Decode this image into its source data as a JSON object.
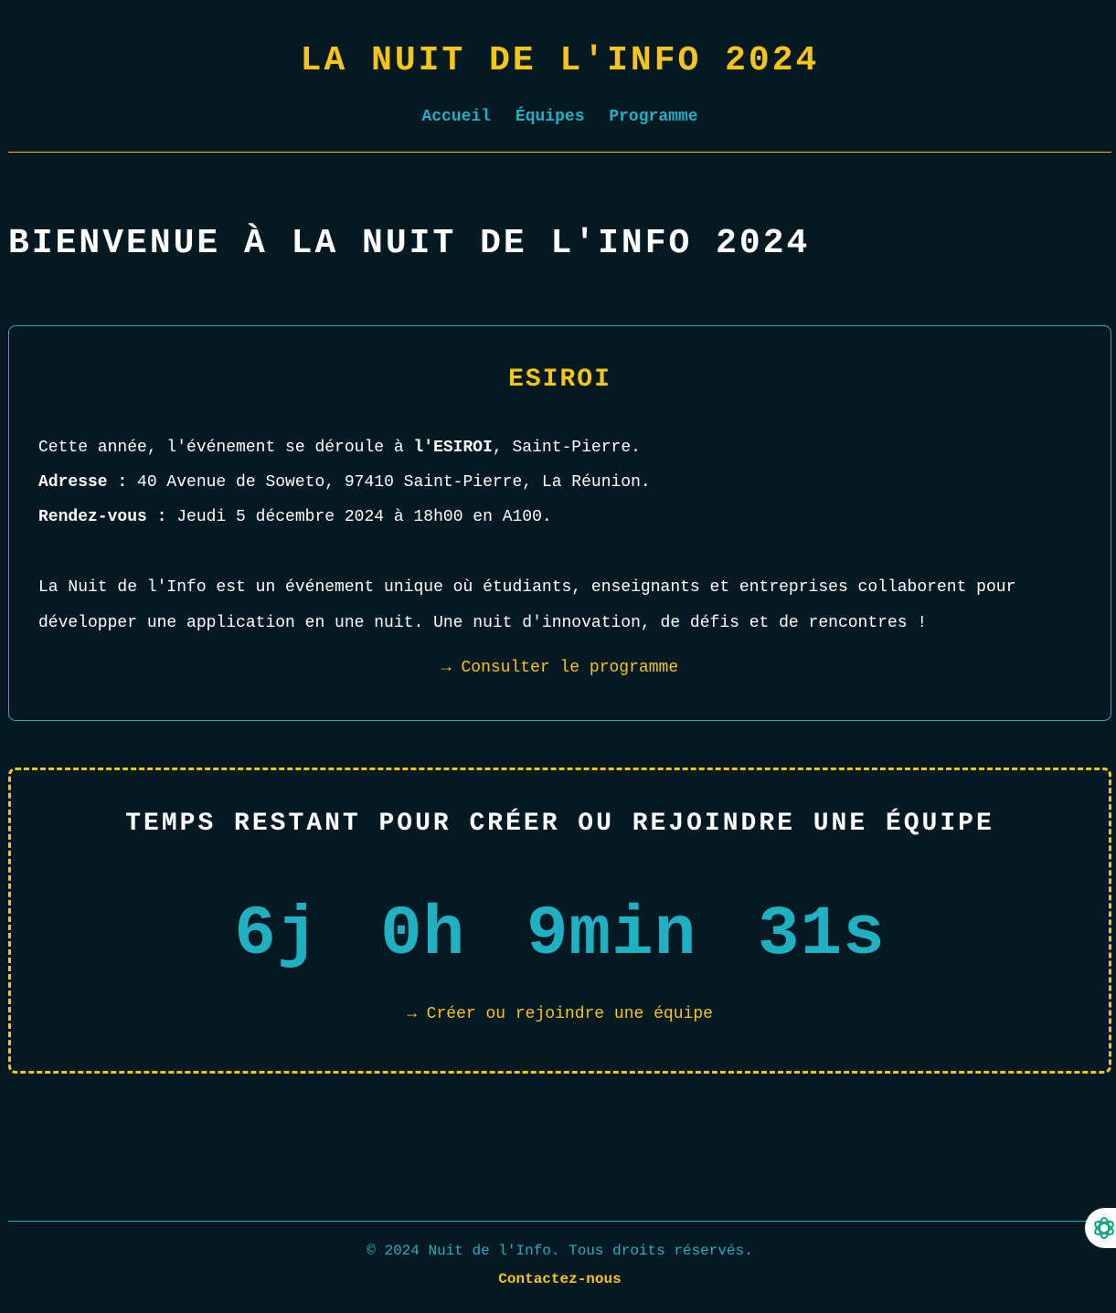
{
  "header": {
    "site_title": "LA NUIT DE L'INFO 2024",
    "nav": [
      {
        "label": "Accueil"
      },
      {
        "label": "Équipes"
      },
      {
        "label": "Programme"
      }
    ]
  },
  "main": {
    "welcome_title": "BIENVENUE À LA NUIT DE L'INFO 2024",
    "info_card": {
      "title": "ESIROI",
      "intro_prefix": "Cette année, l'événement se déroule à ",
      "intro_bold": "l'ESIROI",
      "intro_suffix": ", Saint-Pierre.",
      "address_label": "Adresse :",
      "address_value": " 40 Avenue de Soweto, 97410 Saint-Pierre, La Réunion.",
      "meeting_label": "Rendez-vous :",
      "meeting_value": " Jeudi 5 décembre 2024 à 18h00 en A100.",
      "description": "La Nuit de l'Info est un événement unique où étudiants, enseignants et entreprises collaborent pour développer une application en une nuit. Une nuit d'innovation, de défis et de rencontres !",
      "link_label": "→ Consulter le programme"
    },
    "countdown_card": {
      "title": "TEMPS RESTANT POUR CRÉER OU REJOINDRE UNE ÉQUIPE",
      "days": "6j",
      "hours": "0h",
      "minutes": "9min",
      "seconds": "31s",
      "link_label": "→ Créer ou rejoindre une équipe"
    }
  },
  "footer": {
    "copyright": "© 2024 Nuit de l'Info. Tous droits réservés.",
    "contact_label": "Contactez-nous"
  },
  "colors": {
    "background": "#051923",
    "accent_yellow": "#f5c518",
    "accent_teal": "#1fb0c2",
    "assistant_icon": "#10a37f"
  },
  "icons": {
    "assistant": "assistant-swirl-icon"
  }
}
